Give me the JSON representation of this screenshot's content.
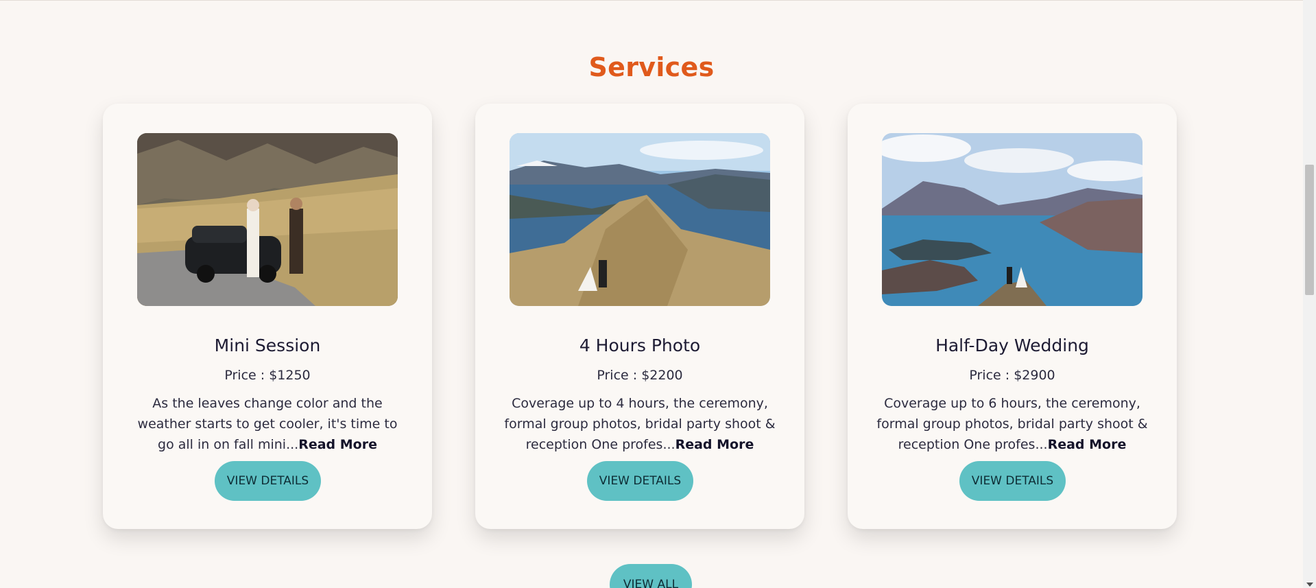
{
  "section": {
    "title": "Services"
  },
  "cards": [
    {
      "title": "Mini Session",
      "price": "Price : $1250",
      "description": "As the leaves change color and the weather starts to get cooler, it's time to go all in on fall mini...",
      "read_more": "Read More",
      "button": "VIEW DETAILS",
      "image": "photo-couple-vintage-car-mountain-field"
    },
    {
      "title": "4 Hours Photo",
      "price": "Price : $2200",
      "description": "Coverage up to 4 hours, the ceremony, formal group photos, bridal party shoot & reception One profes...",
      "read_more": "Read More",
      "button": "VIEW DETAILS",
      "image": "photo-couple-mountain-ridge-lake"
    },
    {
      "title": "Half-Day Wedding",
      "price": "Price : $2900",
      "description": "Coverage up to 6 hours, the ceremony, formal group photos, bridal party shoot & reception One profes...",
      "read_more": "Read More",
      "button": "VIEW DETAILS",
      "image": "photo-couple-summit-blue-lake"
    }
  ],
  "view_all": "VIEW ALL",
  "colors": {
    "accent": "#e05a1c",
    "button": "#5fc1c4",
    "background": "#faf6f3"
  }
}
